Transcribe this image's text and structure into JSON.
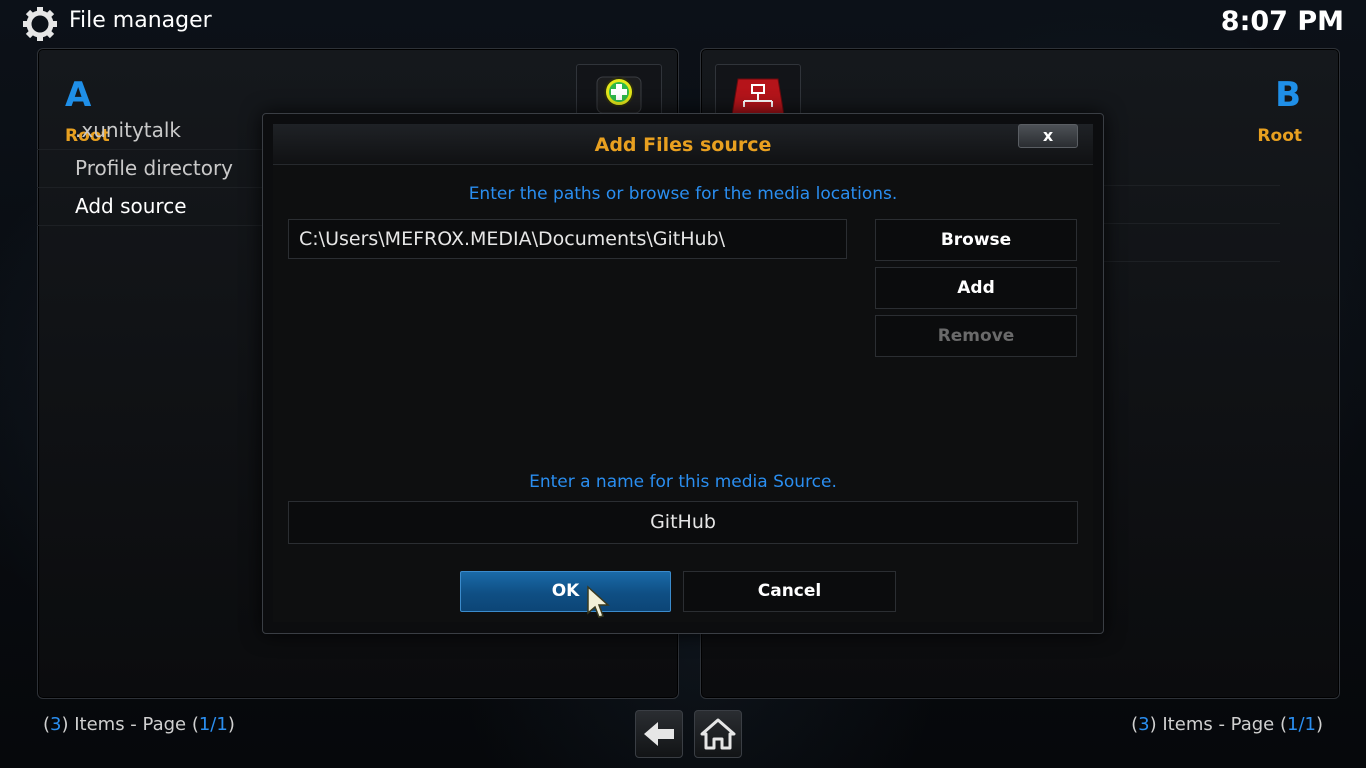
{
  "header": {
    "title": "File manager",
    "clock": "8:07 PM"
  },
  "left_pane": {
    "letter": "A",
    "subtitle": "Root",
    "items": [
      {
        "label": ".xunitytalk"
      },
      {
        "label": "Profile directory"
      },
      {
        "label": "Add source"
      }
    ],
    "footer": {
      "count": "3",
      "page": "1/1"
    }
  },
  "right_pane": {
    "letter": "B",
    "subtitle": "Root",
    "footer": {
      "count": "3",
      "page": "1/1"
    }
  },
  "footer_text": {
    "items_word": "Items - Page"
  },
  "dialog": {
    "title": "Add Files source",
    "close_label": "x",
    "paths_prompt": "Enter the paths or browse for the media locations.",
    "path_value": "C:\\Users\\MEFROX.MEDIA\\Documents\\GitHub\\",
    "browse_label": "Browse",
    "add_label": "Add",
    "remove_label": "Remove",
    "name_prompt": "Enter a name for this media Source.",
    "name_value": "GitHub",
    "ok_label": "OK",
    "cancel_label": "Cancel"
  },
  "icons": {
    "settings": "gear-icon",
    "add_source_tile": "add-icon",
    "network_tile": "network-icon",
    "back": "back-arrow-icon",
    "home": "home-icon",
    "cursor": "mouse-pointer-icon"
  },
  "colors": {
    "accent_blue": "#2a8ef0",
    "accent_orange": "#e8a020",
    "ok_button": "#0f4f84"
  }
}
